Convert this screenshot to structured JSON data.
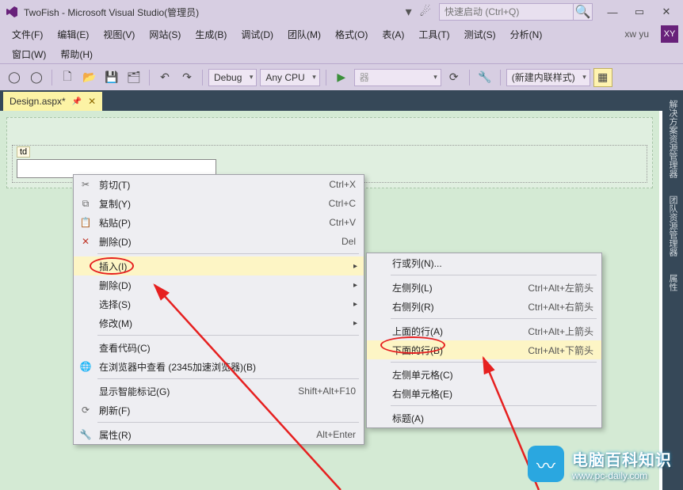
{
  "window": {
    "title": "TwoFish - Microsoft Visual Studio(管理员)"
  },
  "quicklaunch": {
    "placeholder": "快速启动 (Ctrl+Q)"
  },
  "user": {
    "name": "xw yu",
    "initials": "XY"
  },
  "menubar": {
    "items": [
      "文件(F)",
      "编辑(E)",
      "视图(V)",
      "网站(S)",
      "生成(B)",
      "调试(D)",
      "团队(M)",
      "格式(O)",
      "表(A)",
      "工具(T)",
      "测试(S)",
      "分析(N)"
    ],
    "items2": [
      "窗口(W)",
      "帮助(H)"
    ]
  },
  "toolbar": {
    "config": "Debug",
    "platform": "Any CPU",
    "browser_label": "器",
    "style_combo": "(新建内联样式)"
  },
  "tab": {
    "label": "Design.aspx*"
  },
  "td_tag": "td",
  "ctx1": {
    "cut": {
      "label": "剪切(T)",
      "shortcut": "Ctrl+X"
    },
    "copy": {
      "label": "复制(Y)",
      "shortcut": "Ctrl+C"
    },
    "paste": {
      "label": "粘贴(P)",
      "shortcut": "Ctrl+V"
    },
    "delete": {
      "label": "删除(D)",
      "shortcut": "Del"
    },
    "insert": {
      "label": "插入(I)"
    },
    "del2": {
      "label": "删除(D)"
    },
    "select": {
      "label": "选择(S)"
    },
    "modify": {
      "label": "修改(M)"
    },
    "viewcode": {
      "label": "查看代码(C)"
    },
    "openbrowser": {
      "label": "在浏览器中查看 (2345加速浏览器)(B)"
    },
    "smarttag": {
      "label": "显示智能标记(G)",
      "shortcut": "Shift+Alt+F10"
    },
    "refresh": {
      "label": "刷新(F)"
    },
    "props": {
      "label": "属性(R)",
      "shortcut": "Alt+Enter"
    }
  },
  "ctx2": {
    "rowcol": {
      "label": "行或列(N)..."
    },
    "colleft": {
      "label": "左侧列(L)",
      "shortcut": "Ctrl+Alt+左箭头"
    },
    "colright": {
      "label": "右侧列(R)",
      "shortcut": "Ctrl+Alt+右箭头"
    },
    "rowabove": {
      "label": "上面的行(A)",
      "shortcut": "Ctrl+Alt+上箭头"
    },
    "rowbelow": {
      "label": "下面的行(B)",
      "shortcut": "Ctrl+Alt+下箭头"
    },
    "cellleft": {
      "label": "左侧单元格(C)"
    },
    "cellright": {
      "label": "右侧单元格(E)"
    },
    "caption": {
      "label": "标题(A)"
    }
  },
  "rightpanels": [
    "解决方案资源管理器",
    "团队资源管理器",
    "属性"
  ],
  "watermark": {
    "title": "电脑百科知识",
    "url": "www.pc-daily.com"
  }
}
